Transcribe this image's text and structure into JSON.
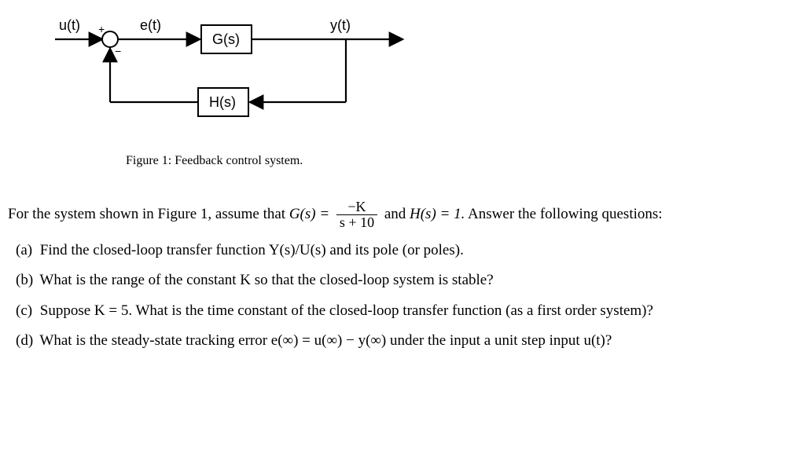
{
  "diagram": {
    "signals": {
      "input": "u(t)",
      "error": "e(t)",
      "output": "y(t)"
    },
    "summer": {
      "top_sign": "+",
      "bottom_sign": "−"
    },
    "blocks": {
      "forward": "G(s)",
      "feedback": "H(s)"
    },
    "caption": "Figure 1: Feedback control system."
  },
  "problem": {
    "intro_1": "For the system shown in Figure 1, assume that ",
    "intro_gs_lhs": "G(s) = ",
    "intro_frac_num": "−K",
    "intro_frac_den": "s + 10",
    "intro_2": " and ",
    "intro_hs": "H(s) = 1.",
    "intro_3": " Answer the following questions:",
    "parts": {
      "a": {
        "label": "(a)",
        "text": "Find the closed-loop transfer function Y(s)/U(s) and its pole (or poles)."
      },
      "b": {
        "label": "(b)",
        "text": "What is the range of the constant K so that the closed-loop system is stable?"
      },
      "c": {
        "label": "(c)",
        "text": "Suppose K = 5. What is the time constant of the closed-loop transfer function (as a first order system)?"
      },
      "d": {
        "label": "(d)",
        "text": "What is the steady-state tracking error e(∞) = u(∞) − y(∞) under the input a unit step input u(t)?"
      }
    }
  }
}
